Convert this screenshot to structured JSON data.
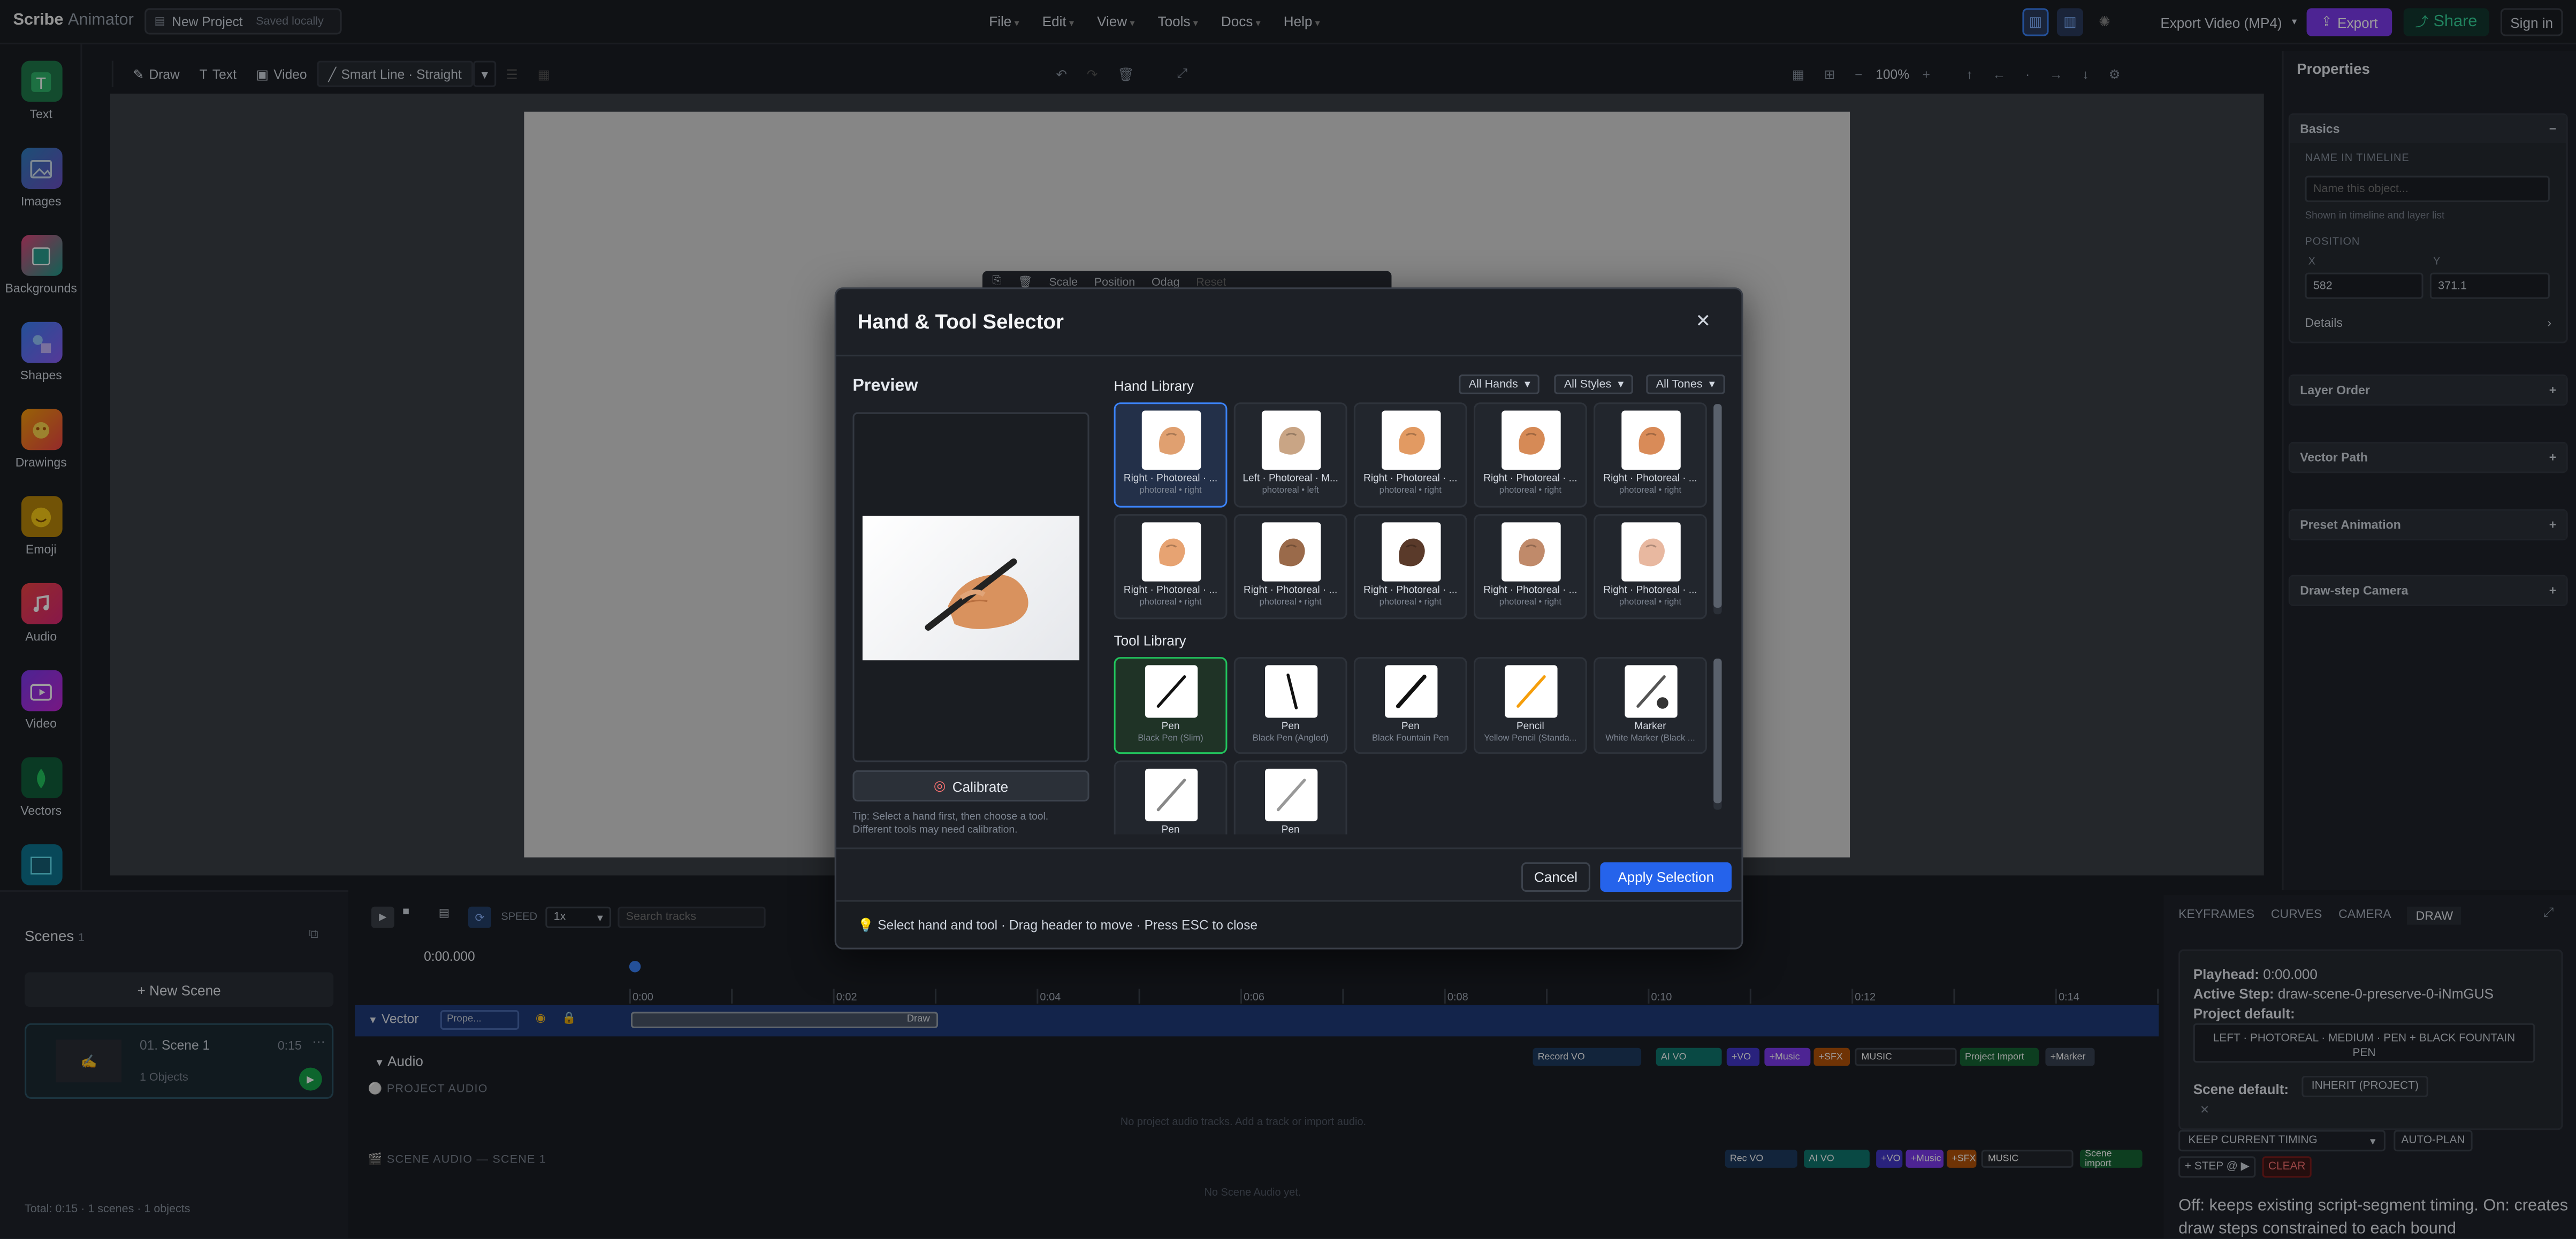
{
  "app": {
    "brand": "Scribe",
    "brand_sub": "Animator",
    "project_name": "New Project",
    "saved_status": "Saved locally"
  },
  "menu": [
    "File",
    "Edit",
    "View",
    "Tools",
    "Docs",
    "Help"
  ],
  "topright": {
    "export_select": "Export Video (MP4)",
    "export_label": "Export",
    "share_label": "Share",
    "signin_label": "Sign in"
  },
  "lefttools": [
    "Text",
    "Images",
    "Backgrounds",
    "Shapes",
    "Drawings",
    "Emoji",
    "Audio",
    "Video",
    "Vectors"
  ],
  "canvas_toolbar": {
    "draw": "Draw",
    "text": "Text",
    "video": "Video",
    "smartline": "Smart Line · Straight",
    "zoom": "100%"
  },
  "selection_toolbar": {
    "scale": "Scale",
    "position": "Position",
    "odrag": "Odag",
    "reset": "Reset"
  },
  "properties": {
    "title": "Properties",
    "basics": "Basics",
    "name_label": "NAME IN TIMELINE",
    "name_placeholder": "Name this object...",
    "name_hint": "Shown in timeline and layer list",
    "position_label": "POSITION",
    "x_label": "X",
    "y_label": "Y",
    "x_value": "582",
    "y_value": "371.1",
    "details": "Details",
    "groups": [
      "Layer Order",
      "Vector Path",
      "Preset Animation",
      "Draw-step Camera"
    ]
  },
  "scenes": {
    "title": "Scenes",
    "count": "1",
    "new_scene": "+ New Scene",
    "scene_index": "01.",
    "scene_name": "Scene 1",
    "scene_duration": "0:15",
    "scene_objects": "1 Objects",
    "total": "Total: 0:15 · 1 scenes · 1 objects"
  },
  "timeline": {
    "speed_label": "SPEED",
    "speed_value": "1x",
    "search_placeholder": "Search tracks",
    "time": "0:00.000",
    "ticks": [
      "0:00",
      "0:02",
      "0:04",
      "0:06",
      "0:08",
      "0:10",
      "0:12",
      "0:14"
    ],
    "vector_track": "Vector",
    "vector_chip": "Prope...",
    "draw_clip": "Draw",
    "audio_track": "Audio",
    "project_audio": "PROJECT AUDIO",
    "no_project_audio": "No project audio tracks. Add a track or import audio.",
    "scene_audio": "SCENE AUDIO — SCENE 1",
    "no_scene_audio": "No Scene Audio yet.",
    "audio_buttons": [
      "Record VO",
      "AI VO",
      "+VO",
      "+Music",
      "+SFX",
      "MUSIC",
      "Project Import",
      "+Marker"
    ],
    "scene_audio_buttons": [
      "Rec VO",
      "AI VO",
      "+VO",
      "+Music",
      "+SFX",
      "MUSIC",
      "Scene import"
    ]
  },
  "draw_panel": {
    "tabs": [
      "KEYFRAMES",
      "CURVES",
      "CAMERA",
      "DRAW"
    ],
    "playhead_label": "Playhead:",
    "playhead_value": "0:00.000",
    "active_label": "Active Step:",
    "active_value": "draw-scene-0-preserve-0-iNmGUS",
    "project_default_label": "Project default:",
    "project_default_value": "LEFT · PHOTOREAL · MEDIUM · PEN + BLACK FOUNTAIN PEN",
    "scene_default_label": "Scene default:",
    "scene_default_value": "INHERIT (PROJECT)",
    "timing_select": "KEEP CURRENT TIMING",
    "autoplan": "AUTO-PLAN",
    "step": "+ STEP @ ▶",
    "clear": "CLEAR",
    "note": "Off: keeps existing script-segment timing. On: creates draw steps constrained to each bound"
  },
  "dialog": {
    "title": "Hand & Tool Selector",
    "preview_label": "Preview",
    "calibrate": "Calibrate",
    "tip": "Tip: Select a hand first, then choose a tool. Different tools may need calibration.",
    "hand_library": "Hand Library",
    "filters": [
      "All Hands",
      "All Styles",
      "All Tones"
    ],
    "tool_library": "Tool Library",
    "hands": [
      {
        "name": "Right · Photoreal · ...",
        "sub": "photoreal • right"
      },
      {
        "name": "Left · Photoreal · M...",
        "sub": "photoreal • left"
      },
      {
        "name": "Right · Photoreal · ...",
        "sub": "photoreal • right"
      },
      {
        "name": "Right · Photoreal · ...",
        "sub": "photoreal • right"
      },
      {
        "name": "Right · Photoreal · ...",
        "sub": "photoreal • right"
      },
      {
        "name": "Right · Photoreal · ...",
        "sub": "photoreal • right"
      },
      {
        "name": "Right · Photoreal · ...",
        "sub": "photoreal • right"
      },
      {
        "name": "Right · Photoreal · ...",
        "sub": "photoreal • right"
      },
      {
        "name": "Right · Photoreal · ...",
        "sub": "photoreal • right"
      },
      {
        "name": "Right · Photoreal · ...",
        "sub": "photoreal • right"
      }
    ],
    "tools": [
      {
        "name": "Pen",
        "sub": "Black Pen (Slim)"
      },
      {
        "name": "Pen",
        "sub": "Black Pen (Angled)"
      },
      {
        "name": "Pen",
        "sub": "Black Fountain Pen"
      },
      {
        "name": "Pencil",
        "sub": "Yellow Pencil (Standa..."
      },
      {
        "name": "Marker",
        "sub": "White Marker (Black ..."
      },
      {
        "name": "Pen",
        "sub": ""
      },
      {
        "name": "Pen",
        "sub": ""
      }
    ],
    "cancel": "Cancel",
    "apply": "Apply Selection",
    "footer": "Select hand and tool · Drag header to move · Press ESC to close"
  }
}
